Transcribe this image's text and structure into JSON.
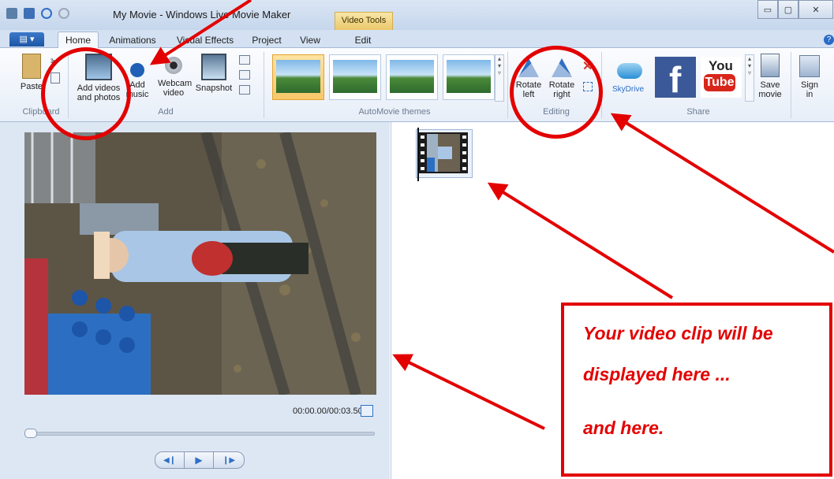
{
  "window": {
    "title": "My Movie - Windows Live Movie Maker",
    "context_tab_title": "Video Tools",
    "controls": [
      "minimize",
      "maximize",
      "close"
    ]
  },
  "tabs": [
    {
      "label": "Home",
      "active": true
    },
    {
      "label": "Animations",
      "active": false
    },
    {
      "label": "Visual Effects",
      "active": false
    },
    {
      "label": "Project",
      "active": false
    },
    {
      "label": "View",
      "active": false
    },
    {
      "label": "Edit",
      "active": false
    }
  ],
  "ribbon": {
    "clipboard": {
      "paste": "Paste",
      "group": "Clipboard"
    },
    "add": {
      "add_videos": [
        "Add videos",
        "and photos"
      ],
      "add_music": [
        "Add",
        "music"
      ],
      "webcam": [
        "Webcam",
        "video"
      ],
      "snapshot": "Snapshot",
      "group": "Add"
    },
    "themes": {
      "group": "AutoMovie themes"
    },
    "editing": {
      "rotate_left": [
        "Rotate",
        "left"
      ],
      "rotate_right": [
        "Rotate",
        "right"
      ],
      "group": "Editing"
    },
    "share": {
      "skydrive": "SkyDrive",
      "facebook": "f",
      "youtube_top": "You",
      "youtube_bottom": "Tube",
      "save_movie": [
        "Save",
        "movie"
      ],
      "sign_in": [
        "Sign",
        "in"
      ],
      "group": "Share"
    }
  },
  "preview": {
    "timecode": "00:00.00/00:03.50",
    "position_fraction": 0.0
  },
  "annotation": {
    "line1": "Your video clip will be",
    "line2": "displayed here ...",
    "line3": "and here."
  },
  "colors": {
    "annotation": "#e30000",
    "accent": "#2a6cc7"
  }
}
